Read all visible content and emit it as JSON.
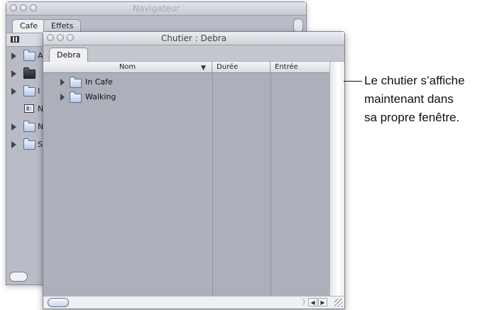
{
  "navigator_window": {
    "title": "Navigateur",
    "tabs": [
      {
        "label": "Cafe"
      },
      {
        "label": "Effets"
      }
    ],
    "partial_labels": [
      "A",
      "",
      "I",
      "N",
      "N",
      "S"
    ]
  },
  "bin_window": {
    "title": "Chutier : Debra",
    "tab": "Debra",
    "columns": {
      "name": "Nom",
      "duration": "Durée",
      "in": "Entrée"
    },
    "items": [
      {
        "label": "In Cafe"
      },
      {
        "label": "Walking"
      }
    ]
  },
  "callout": {
    "lines": [
      "Le chutier s’affiche",
      "maintenant dans",
      "sa propre fenêtre."
    ]
  }
}
